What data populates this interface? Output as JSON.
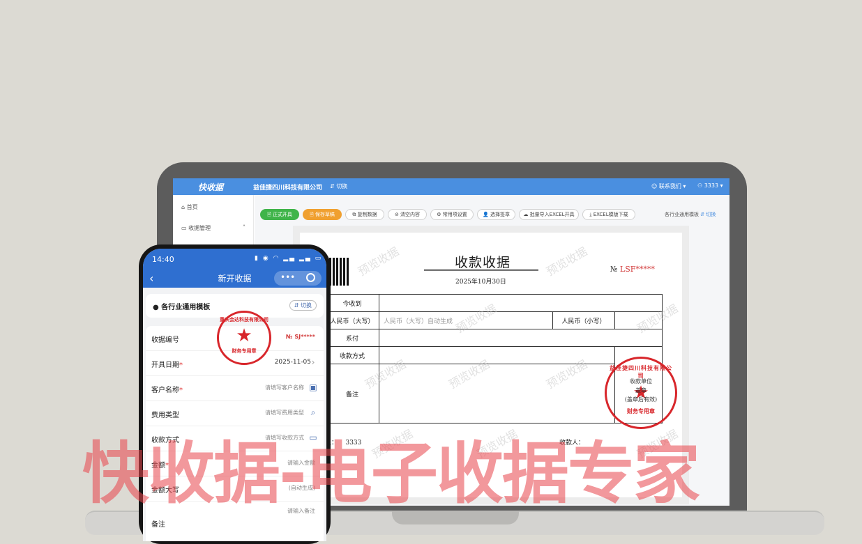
{
  "app": {
    "logo": "快收据",
    "company": "益佳捷四川科技有限公司",
    "switch": "切换",
    "contact": "联系我们",
    "user": "3333"
  },
  "sidebar": {
    "items": [
      {
        "label": "首页",
        "icon": "home-icon"
      },
      {
        "label": "收据管理",
        "icon": "receipt-icon"
      }
    ]
  },
  "toolbar": {
    "buttons": [
      {
        "label": "正式开具",
        "style": "green"
      },
      {
        "label": "保存草稿",
        "style": "orange"
      },
      {
        "label": "复制数据",
        "style": "plain"
      },
      {
        "label": "清空内容",
        "style": "plain"
      },
      {
        "label": "常用项设置",
        "style": "plain"
      },
      {
        "label": "选择签章",
        "style": "plain"
      },
      {
        "label": "批量导入EXCEL开具",
        "style": "plain"
      },
      {
        "label": "EXCEL模版下载",
        "style": "plain"
      }
    ],
    "template": "各行业通用模板",
    "template_switch": "切换"
  },
  "receipt": {
    "title": "收款收据",
    "date": "2025年10月30日",
    "no_label": "№",
    "no_value": "LSF*****",
    "rows": {
      "received_from": "今收到",
      "rmb_upper": "人民币（大写）",
      "rmb_upper_placeholder": "人民币（大写）自动生成",
      "rmb_lower": "人民币（小写）",
      "paid_for": "系付",
      "method": "收款方式",
      "remark": "备注"
    },
    "payee_label": "人：",
    "payee_value": "3333",
    "collector_label": "收款人：",
    "stamp_inner": [
      "收款单位",
      "盖章",
      "(盖章后有效)"
    ],
    "stamp_top": "益佳捷四川科技有限公司",
    "stamp_bottom": "财务专用章",
    "watermark": "预览收据"
  },
  "phone": {
    "time": "14:40",
    "title": "新开收据",
    "template": "各行业通用模板",
    "template_switch": "切换",
    "stamp_top": "重庆会达科技有限公司",
    "stamp_bottom": "财务专用章",
    "fields": [
      {
        "label": "收据编号",
        "value": "№ SJ*****",
        "required": false
      },
      {
        "label": "开具日期",
        "value": "2025-11-05",
        "required": true
      },
      {
        "label": "客户名称",
        "value": "请填写客户名称",
        "required": true
      },
      {
        "label": "费用类型",
        "value": "请填写费用类型",
        "required": false
      },
      {
        "label": "收款方式",
        "value": "请填写收款方式",
        "required": false
      },
      {
        "label": "金额",
        "value": "请输入金额",
        "required": true
      },
      {
        "label": "金额大写",
        "value": "(自动生成)",
        "required": false
      },
      {
        "label": "备注",
        "value": "请输入备注",
        "required": false
      }
    ]
  },
  "slogan": "快收据-电子收据专家",
  "colors": {
    "brand_blue": "#4a8fe0",
    "stamp_red": "#d8262b",
    "slogan_red": "#e9454c"
  }
}
